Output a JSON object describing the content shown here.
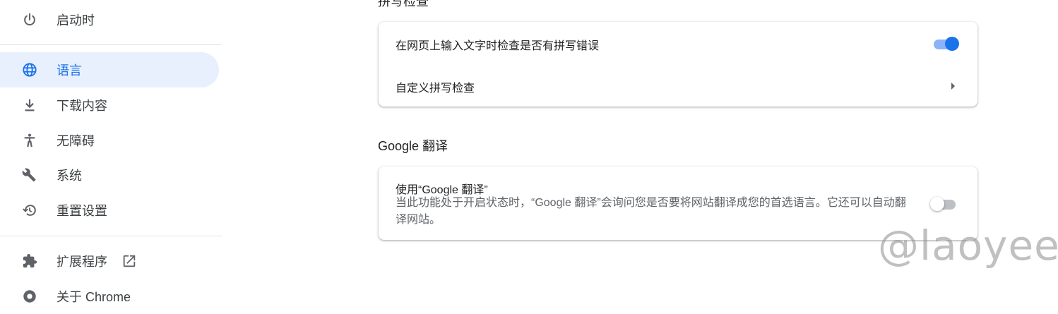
{
  "sidebar": {
    "items": [
      {
        "label": "启动时",
        "icon": "power-icon"
      },
      {
        "label": "语言",
        "icon": "globe-icon",
        "active": true
      },
      {
        "label": "下载内容",
        "icon": "download-icon"
      },
      {
        "label": "无障碍",
        "icon": "accessibility-icon"
      },
      {
        "label": "系统",
        "icon": "wrench-icon"
      },
      {
        "label": "重置设置",
        "icon": "restore-icon"
      },
      {
        "label": "扩展程序",
        "icon": "puzzle-icon",
        "external": "open-in-new-icon"
      },
      {
        "label": "关于 Chrome",
        "icon": "chrome-icon"
      }
    ]
  },
  "main": {
    "spellcheck_title": "拼写检查",
    "spellcheck": {
      "toggle_label": "在网页上输入文字时检查是否有拼写错误",
      "toggle_on": true,
      "custom_label": "自定义拼写检查"
    },
    "translate_title": "Google 翻译",
    "translate": {
      "label": "使用“Google 翻译”",
      "description": "当此功能处于开启状态时，“Google 翻译”会询问您是否要将网站翻译成您的首选语言。它还可以自动翻译网站。",
      "toggle_on": false
    }
  },
  "watermark": "@laoyee",
  "colors": {
    "accent": "#1a73e8",
    "active_bg": "#e8f0fe",
    "icon": "#5f6368"
  }
}
